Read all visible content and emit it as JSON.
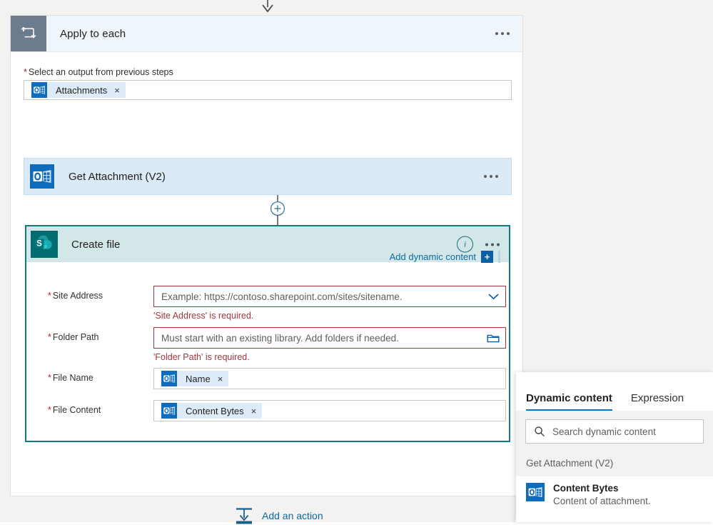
{
  "scope": {
    "title": "Apply to each",
    "icon": "loop-icon",
    "output_field": {
      "label": "Select an output from previous steps",
      "required_marker": "*",
      "token": {
        "label": "Attachments",
        "icon": "outlook-icon",
        "remove": "×"
      }
    }
  },
  "get_attachment_card": {
    "title": "Get Attachment (V2)",
    "icon": "outlook-icon"
  },
  "create_file_card": {
    "title": "Create file",
    "icon": "sharepoint-icon",
    "info_glyph": "i",
    "fields": [
      {
        "label": "Site Address",
        "required_marker": "*",
        "placeholder": "Example: https://contoso.sharepoint.com/sites/sitename.",
        "control": "dropdown",
        "error": "'Site Address' is required."
      },
      {
        "label": "Folder Path",
        "required_marker": "*",
        "placeholder": "Must start with an existing library. Add folders if needed.",
        "control": "folder-picker",
        "error": "'Folder Path' is required."
      },
      {
        "label": "File Name",
        "required_marker": "*",
        "token": {
          "label": "Name",
          "icon": "outlook-icon",
          "remove": "×"
        }
      },
      {
        "label": "File Content",
        "required_marker": "*",
        "token": {
          "label": "Content Bytes",
          "icon": "outlook-icon",
          "remove": "×"
        }
      }
    ],
    "add_dynamic_content": {
      "label": "Add dynamic content",
      "plus": "+"
    }
  },
  "add_action": {
    "label": "Add an action",
    "icon": "add-action-icon"
  },
  "dynamic_content_panel": {
    "tabs": [
      {
        "label": "Dynamic content",
        "active": true
      },
      {
        "label": "Expression",
        "active": false
      }
    ],
    "search_placeholder": "Search dynamic content",
    "groups": [
      {
        "title": "Get Attachment (V2)",
        "items": [
          {
            "name": "Content Bytes",
            "description": "Content of attachment.",
            "icon": "outlook-icon"
          }
        ]
      }
    ]
  },
  "colors": {
    "scope_header": "#eff6fb",
    "scope_icon": "#6b7c8e",
    "outlook_blue": "#0f6cbd",
    "sharepoint_teal": "#036c70",
    "selected_border": "#0c7c84",
    "createfile_header": "#d4e7e8",
    "error_red": "#a4373a",
    "link_blue": "#0b6a9e",
    "tab_underline": "#0078d4",
    "token_bg": "#deecf9"
  }
}
